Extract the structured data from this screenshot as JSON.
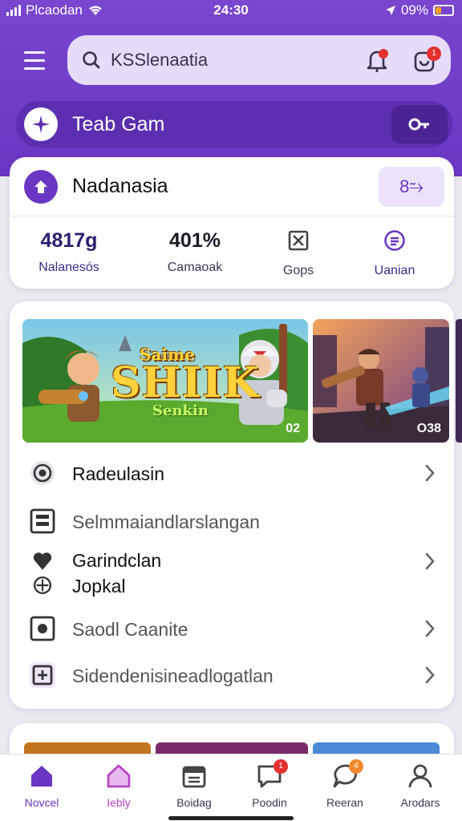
{
  "status": {
    "carrier": "Plcaodan",
    "time": "24:30",
    "battery_text": "09%"
  },
  "search": {
    "value": "KSSlenaatia",
    "placeholder": "KSSlenaatia"
  },
  "header": {
    "cart_badge": "1",
    "team_title": "Teab Gam"
  },
  "profile": {
    "name": "Nadanasia",
    "link_label": "8⥲",
    "stats": [
      {
        "value": "4817g",
        "label": "Nalanesós"
      },
      {
        "value": "401%",
        "label": "Camaoak"
      },
      {
        "value": "",
        "label": "Gops"
      },
      {
        "value": "",
        "label": "Uanian"
      }
    ]
  },
  "banners": {
    "main_title_line1": "Saime",
    "main_title_line2": "SHIIK",
    "main_title_line3": "Senkin",
    "main_count": "02",
    "side_count": "O38"
  },
  "menu": {
    "items": [
      {
        "label": "Radeulasin"
      },
      {
        "label": "Selmmaiandlarslangan"
      },
      {
        "label_line1": "Garindclan",
        "label_line2": "Jopkal"
      },
      {
        "label": "Saodl Caanite"
      },
      {
        "label": "Sidendenisineadlogatlan"
      }
    ]
  },
  "nav": {
    "items": [
      {
        "label": "Novcel"
      },
      {
        "label": "Iebly"
      },
      {
        "label": "Boidag"
      },
      {
        "label": "Poodin",
        "badge": "1"
      },
      {
        "label": "Reeran",
        "badge": "4"
      },
      {
        "label": "Arodars"
      }
    ]
  },
  "colors": {
    "brand_purple": "#6a36c3",
    "header_dark": "#5b2fb0",
    "badge_red": "#e53030",
    "badge_orange": "#f0892b",
    "battery_orange": "#f7a21b"
  },
  "icons": [
    "menu-icon",
    "search-icon",
    "bell-icon",
    "cart-icon",
    "compass-icon",
    "key-icon",
    "home-up-icon",
    "grid-box-icon",
    "coin-icon",
    "target-icon",
    "list-icon",
    "heart-shield-icon",
    "camera-icon",
    "plus-box-icon",
    "chevron-right-icon",
    "home-icon",
    "calendar-icon",
    "chat-icon",
    "speech-icon",
    "user-icon"
  ]
}
